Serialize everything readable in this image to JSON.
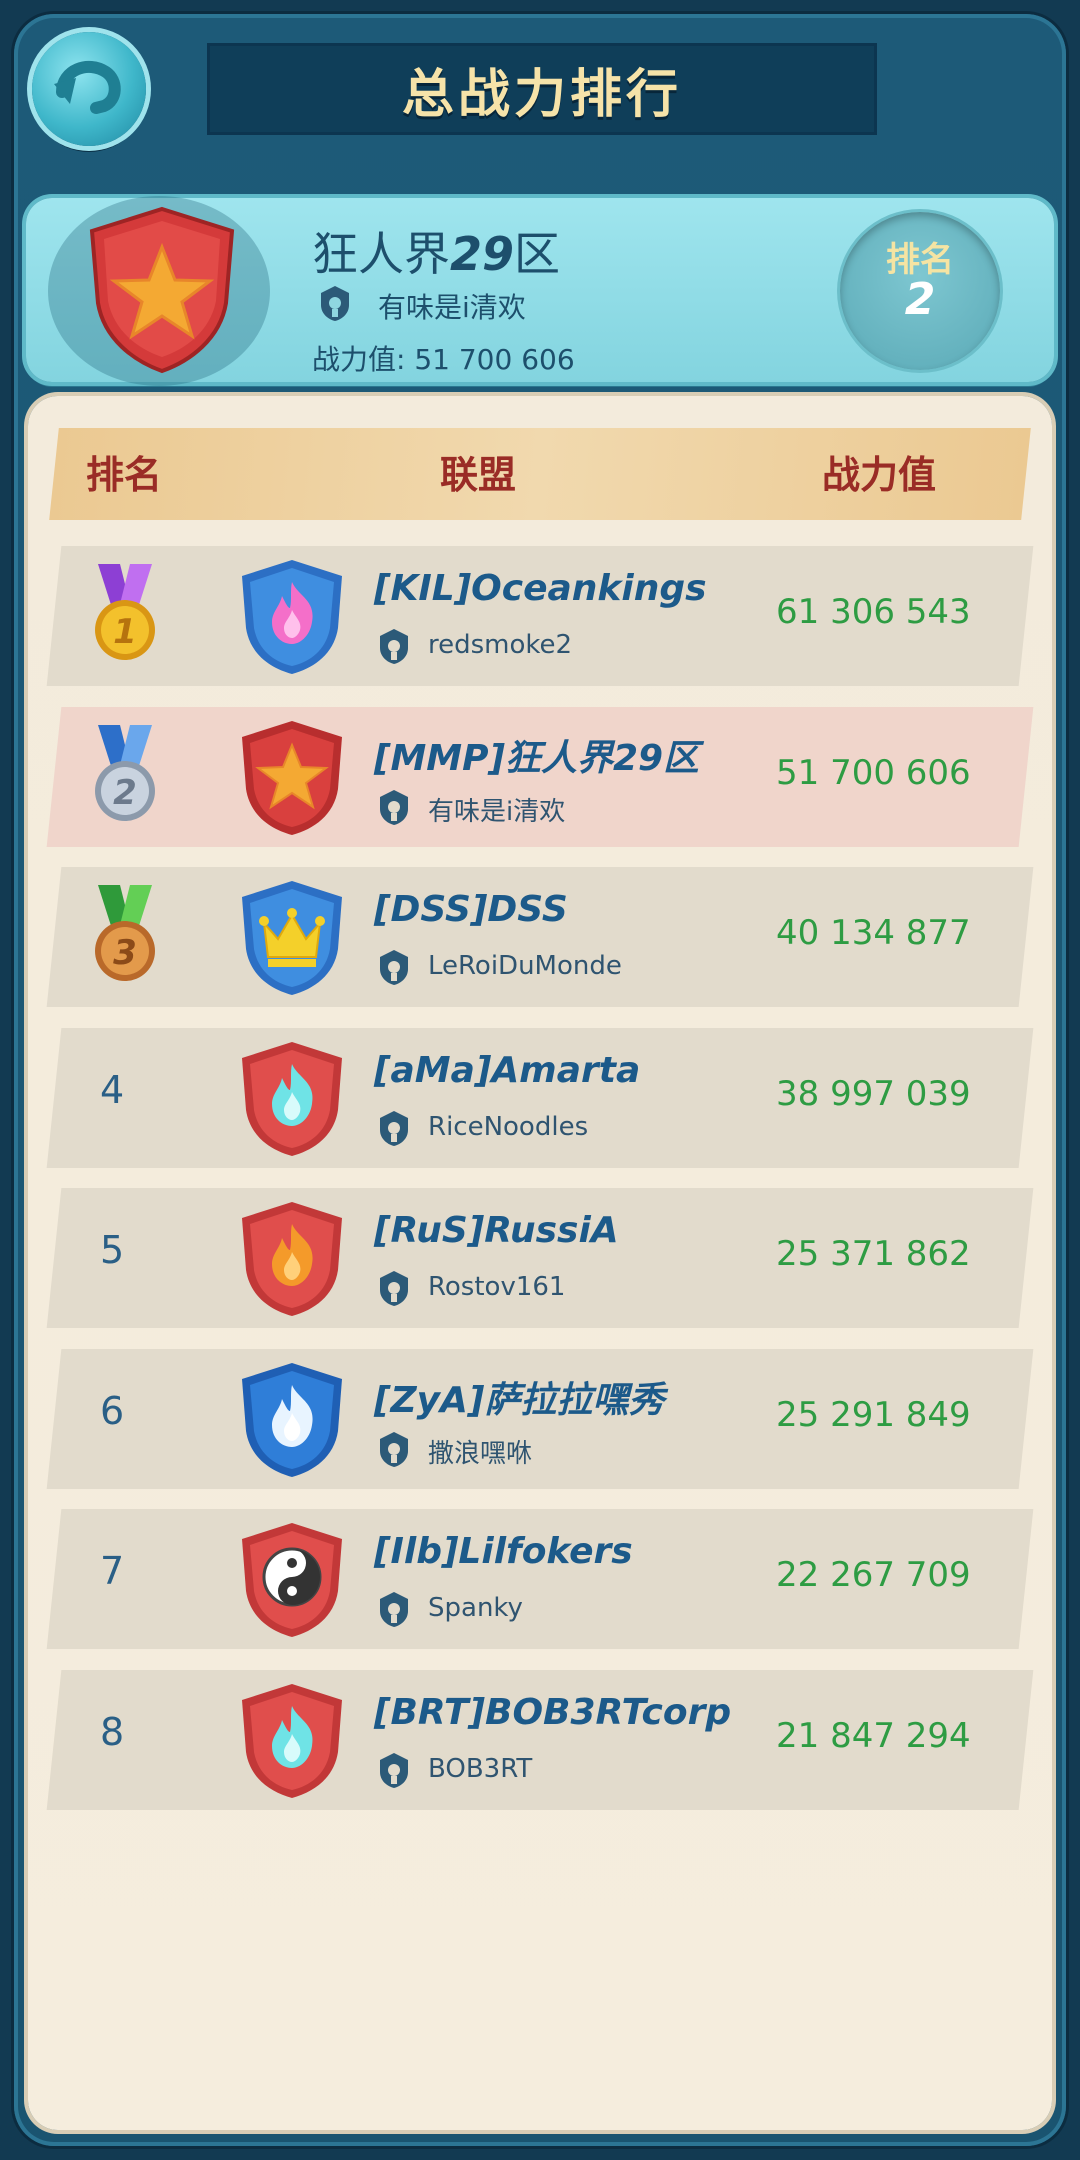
{
  "header": {
    "title": "总战力排行"
  },
  "player": {
    "name_prefix": "狂人界",
    "name_number": "29",
    "name_suffix": "区",
    "leader": "有味是i清欢",
    "power_text": "战力值: 51 700 606",
    "rank_label": "排名",
    "rank_value": "2"
  },
  "columns": {
    "rank": "排名",
    "alliance": "联盟",
    "power": "战力值"
  },
  "rows": [
    {
      "rank": "1",
      "alliance": "[KIL]Oceankings",
      "leader": "redsmoke2",
      "power": "61 306 543"
    },
    {
      "rank": "2",
      "alliance": "[MMP]狂人界29区",
      "leader": "有味是i清欢",
      "power": "51 700 606"
    },
    {
      "rank": "3",
      "alliance": "[DSS]DSS",
      "leader": "LeRoiDuMonde",
      "power": "40 134 877"
    },
    {
      "rank": "4",
      "alliance": "[aMa]Amarta",
      "leader": "RiceNoodles",
      "power": "38 997 039"
    },
    {
      "rank": "5",
      "alliance": "[RuS]RussiA",
      "leader": "Rostov161",
      "power": "25 371 862"
    },
    {
      "rank": "6",
      "alliance": "[ZyA]萨拉拉嘿秀",
      "leader": "撒浪嘿咻",
      "power": "25 291 849"
    },
    {
      "rank": "7",
      "alliance": "[Ilb]Lilfokers",
      "leader": "Spanky",
      "power": "22 267 709"
    },
    {
      "rank": "8",
      "alliance": "[BRT]BOB3RTcorp",
      "leader": "BOB3RT",
      "power": "21 847 294"
    }
  ],
  "icons": {
    "back": "back-arrow-icon",
    "leader": "helmet-icon",
    "medals": [
      "gold-medal-icon",
      "silver-medal-icon",
      "bronze-medal-icon"
    ],
    "emblems": [
      "pink-flame-blue-shield",
      "star-red-shield",
      "crown-blue-shield",
      "cyan-flame-red-shield",
      "orange-flame-red-shield",
      "white-flame-blue-shield",
      "yin-yang-red-shield",
      "cyan-flame-red-shield"
    ]
  },
  "colors": {
    "title": "#f6e3a9",
    "header_text": "#9a2c26",
    "alliance": "#1c5a8a",
    "power": "#2e9c43",
    "row": "#e2dbcc",
    "row_highlight": "#f0d5cb"
  }
}
